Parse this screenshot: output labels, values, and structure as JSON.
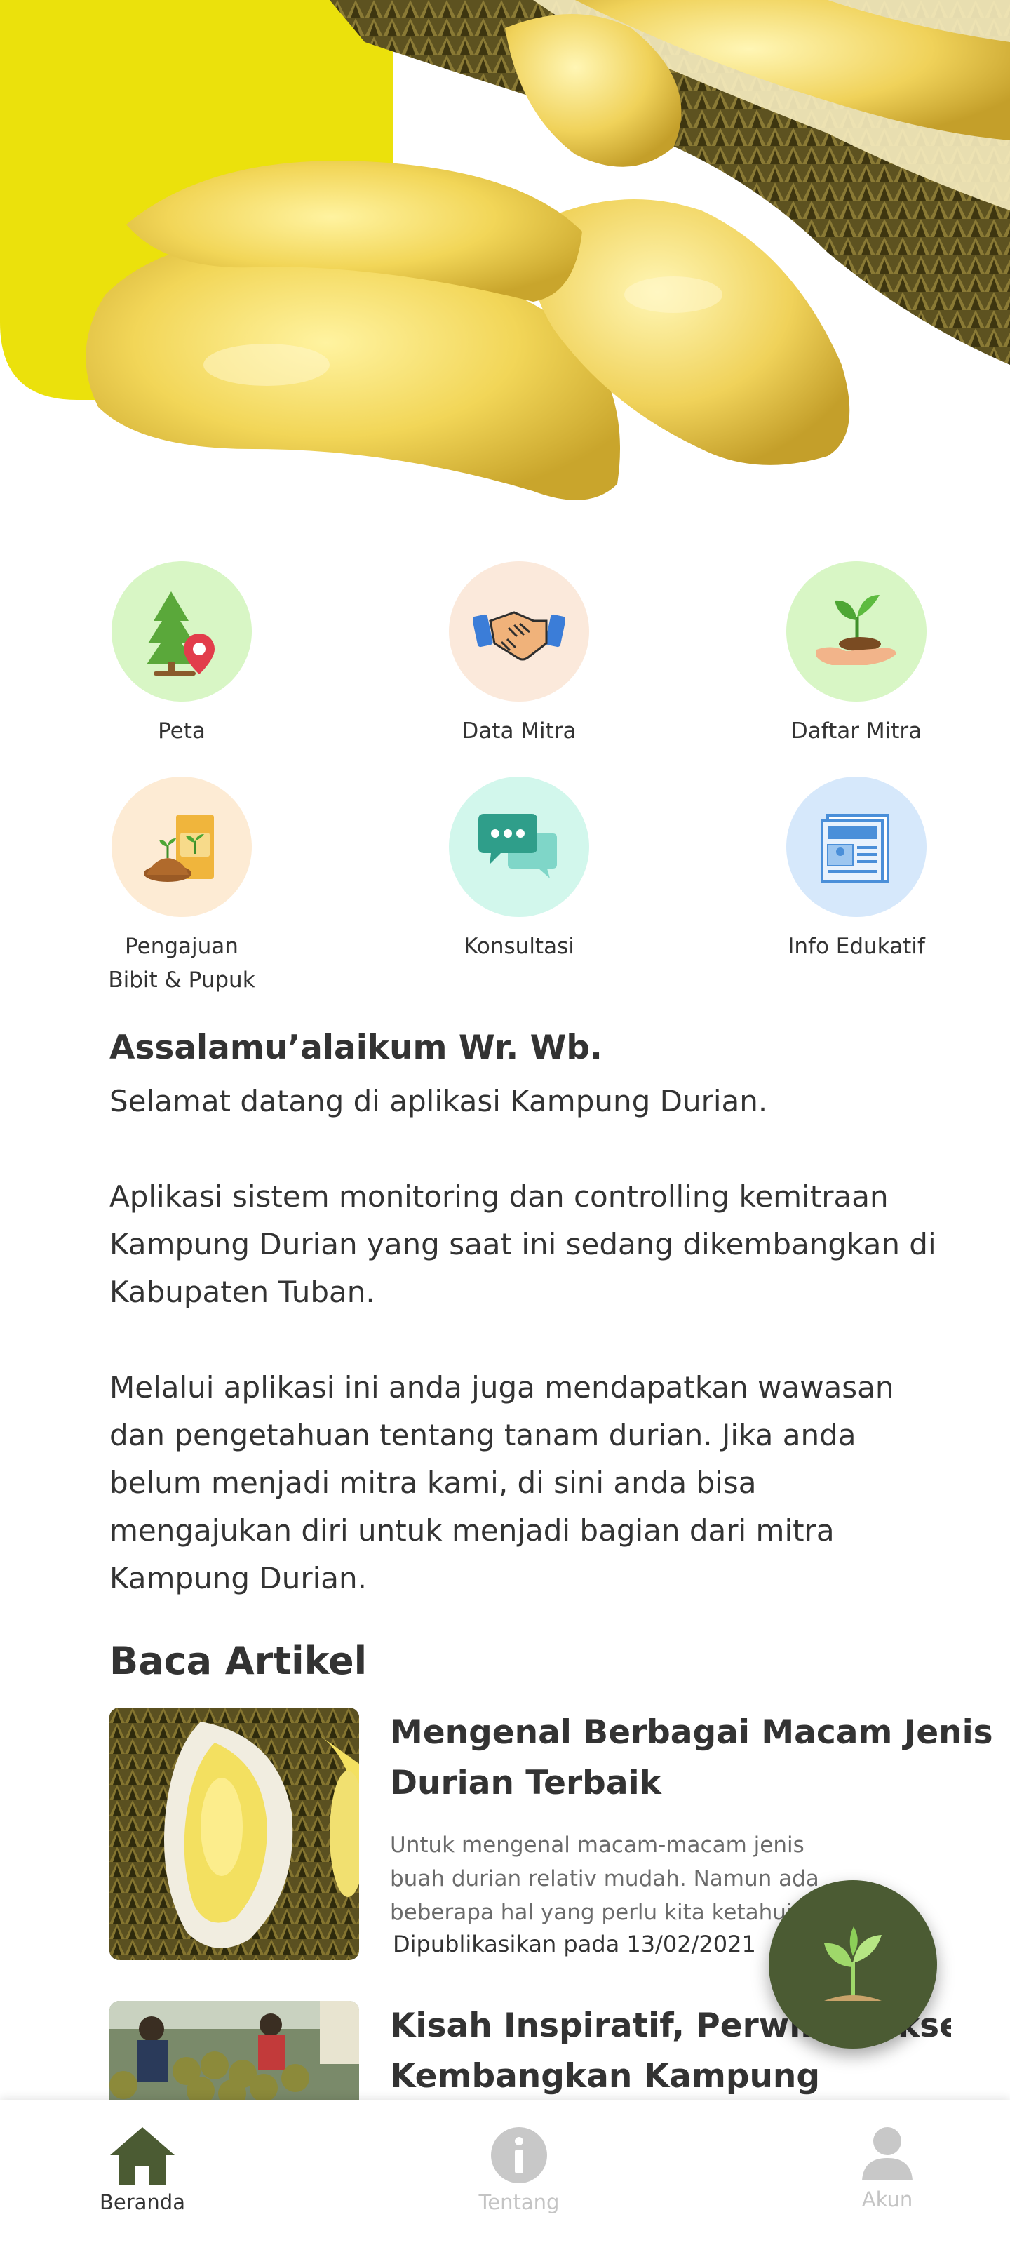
{
  "menu": {
    "items": [
      {
        "label": "Peta",
        "icon": "tree-map-pin-icon",
        "color": "#d8f6c5"
      },
      {
        "label": "Data Mitra",
        "icon": "handshake-icon",
        "color": "#fbe9db"
      },
      {
        "label": "Daftar Mitra",
        "icon": "sprout-hand-icon",
        "color": "#d8f6c5"
      },
      {
        "label": "Pengajuan\nBibit & Pupuk",
        "label_line1": "Pengajuan",
        "label_line2": "Bibit & Pupuk",
        "icon": "fertilizer-bag-icon",
        "color": "#fdebd4"
      },
      {
        "label": "Konsultasi",
        "icon": "chat-bubbles-icon",
        "color": "#d2f7ec"
      },
      {
        "label": "Info Edukatif",
        "icon": "newspaper-icon",
        "color": "#d6e8fb"
      }
    ]
  },
  "greeting": {
    "title": "Assalamu’alaikum Wr. Wb.",
    "line1": "Selamat datang di aplikasi Kampung Durian.",
    "para2": "Aplikasi sistem monitoring dan controlling kemitraan Kampung Durian yang saat ini sedang dikembangkan di Kabupaten Tuban.",
    "para3": "Melalui aplikasi ini anda juga mendapatkan wawasan  dan pengetahuan tentang tanam durian. Jika anda belum menjadi mitra kami, di sini anda bisa mengajukan diri untuk menjadi bagian dari mitra Kampung Durian."
  },
  "articles": {
    "section_title": "Baca Artikel",
    "items": [
      {
        "title": "Mengenal Berbagai Macam Jenis Durian Terbaik",
        "excerpt": "Untuk mengenal macam-macam jenis buah durian relativ mudah. Namun ada beberapa hal yang perlu kita ketahui ...",
        "date": "Dipublikasikan pada 13/02/2021"
      },
      {
        "title": "Kisah Inspiratif, Perwira Sukses Kembangkan Kampung"
      }
    ]
  },
  "fab": {
    "icon": "sprout-icon",
    "color": "#4b5b33"
  },
  "bottom_nav": {
    "items": [
      {
        "label": "Beranda",
        "icon": "home-icon",
        "active": true
      },
      {
        "label": "Tentang",
        "icon": "info-icon",
        "active": false
      },
      {
        "label": "Akun",
        "icon": "user-icon",
        "active": false
      }
    ],
    "active_color": "#4b5b33",
    "inactive_color": "#c4c4c4"
  },
  "colors": {
    "accent_yellow": "#ebe10c",
    "text": "#333333"
  }
}
